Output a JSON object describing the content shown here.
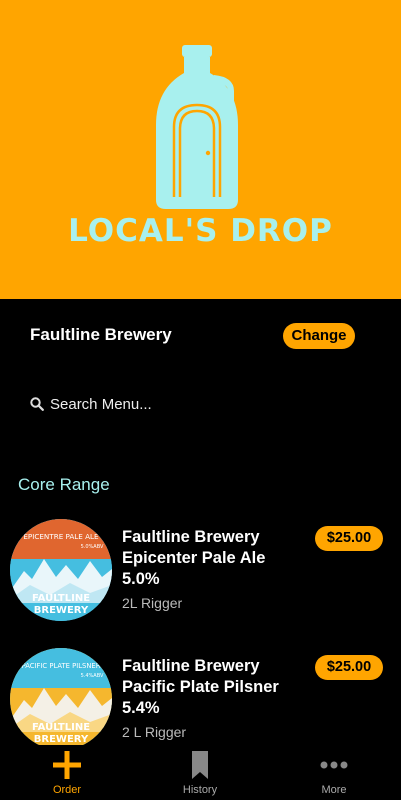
{
  "hero": {
    "brand_name": "LOCAL'S DROP"
  },
  "brewery": {
    "name": "Faultline Brewery",
    "change_label": "Change"
  },
  "search": {
    "placeholder": "Search Menu..."
  },
  "section": {
    "title": "Core Range"
  },
  "products": [
    {
      "name": "Faultline Brewery Epicenter Pale Ale 5.0%",
      "size": "2L Rigger",
      "price": "$25.00",
      "label_title": "EPICENTRE PALE ALE",
      "label_abv": "5.0%ABV",
      "label_brand_1": "FAULTLINE",
      "label_brand_2": "BREWERY"
    },
    {
      "name": "Faultline Brewery Pacific Plate Pilsner 5.4%",
      "size": "2 L Rigger",
      "price": "$25.00",
      "label_title": "PACIFIC PLATE PILSNER",
      "label_abv": "5.4%ABV",
      "label_brand_1": "FAULTLINE",
      "label_brand_2": "BREWERY"
    }
  ],
  "tabs": [
    {
      "label": "Order",
      "icon": "plus-icon"
    },
    {
      "label": "History",
      "icon": "bookmark-icon"
    },
    {
      "label": "More",
      "icon": "more-dots-icon"
    }
  ],
  "colors": {
    "accent": "#FFA500",
    "brand_teal": "#A8F0EE",
    "background": "#000000"
  }
}
